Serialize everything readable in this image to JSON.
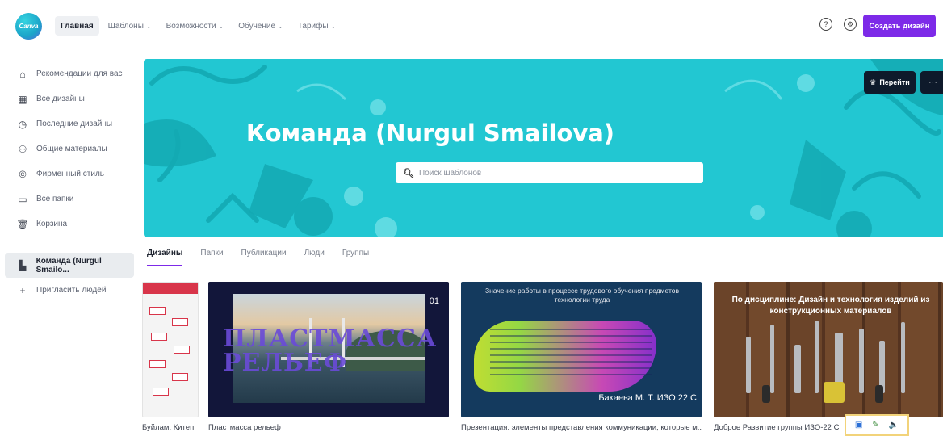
{
  "app": {
    "logo_text": "Canva",
    "nav": [
      {
        "label": "Главная",
        "active": true,
        "has_menu": false
      },
      {
        "label": "Шаблоны",
        "active": false,
        "has_menu": true
      },
      {
        "label": "Возможности",
        "active": false,
        "has_menu": true
      },
      {
        "label": "Обучение",
        "active": false,
        "has_menu": true
      },
      {
        "label": "Тарифы",
        "active": false,
        "has_menu": true
      }
    ],
    "help_icon": "help-circle-icon",
    "settings_icon": "settings-gear-icon",
    "create_button": "Создать дизайн",
    "accent_color": "#7d2ae8"
  },
  "sidebar": {
    "items": [
      {
        "label": "Рекомендации для вас",
        "icon": "home-icon"
      },
      {
        "label": "Все дизайны",
        "icon": "grid-icon"
      },
      {
        "label": "Последние дизайны",
        "icon": "clock-icon"
      },
      {
        "label": "Общие материалы",
        "icon": "people-icon"
      },
      {
        "label": "Фирменный стиль",
        "icon": "brand-icon"
      },
      {
        "label": "Все папки",
        "icon": "folder-icon"
      },
      {
        "label": "Корзина",
        "icon": "trash-icon"
      }
    ],
    "team": {
      "label": "Команда (Nurgul Smailo...",
      "icon": "team-icon"
    },
    "invite": {
      "label": "Пригласить людей",
      "icon": "plus-icon"
    }
  },
  "hero": {
    "title": "Команда (Nurgul Smailova)",
    "search_placeholder": "Поиск шаблонов",
    "button_label": "Перейти",
    "more_label": "···",
    "background_color": "#22c7d2"
  },
  "tabs": [
    {
      "label": "Дизайны",
      "active": true
    },
    {
      "label": "Папки",
      "active": false
    },
    {
      "label": "Публикации",
      "active": false
    },
    {
      "label": "Люди",
      "active": false
    },
    {
      "label": "Группы",
      "active": false
    }
  ],
  "designs": [
    {
      "title": "Буйлам. Китеп",
      "preview_text": ""
    },
    {
      "title": "Пластмасса рельеф",
      "preview_text": "ПЛАСТМАССА РЕЛЬЕФ",
      "page_number": "01"
    },
    {
      "title": "Презентация: элементы представления коммуникации, которые м...",
      "preview_heading": "Значение работы в процессе трудового обучения предметов технологии труда",
      "preview_author": "Бакаева М. Т. ИЗО 22 С"
    },
    {
      "title": "Доброе Развитие группы ИЗО-22 С",
      "preview_heading": "По дисциплине: Дизайн и технология изделий из конструкционных материалов"
    }
  ],
  "tray_icons": [
    "screen-icon",
    "pen-icon",
    "speaker-icon"
  ]
}
